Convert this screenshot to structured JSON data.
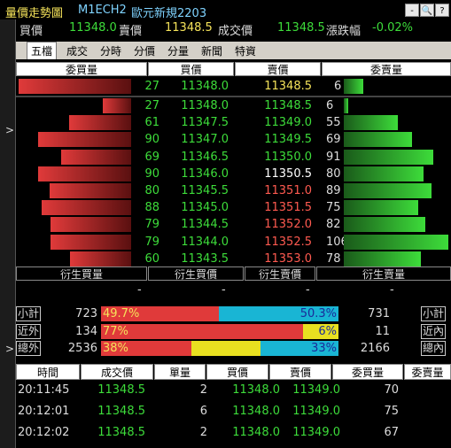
{
  "title_bar": {
    "window_title": "量價走勢圖",
    "symbol": "M1ECH2",
    "name": "歐元新規2203",
    "buttons": [
      "-",
      "🔍",
      "?"
    ]
  },
  "quote_line": {
    "buy_label": "買價",
    "buy_value": "11348.0",
    "sell_label": "賣價",
    "sell_value": "11348.5",
    "trade_label": "成交價",
    "trade_value": "11348.5",
    "change_label": "漲跌幅",
    "change_value": "-0.02%"
  },
  "tabs": [
    {
      "label": "五檔",
      "active": true
    },
    {
      "label": "成交",
      "active": false
    },
    {
      "label": "分時",
      "active": false
    },
    {
      "label": "分價",
      "active": false
    },
    {
      "label": "分量",
      "active": false
    },
    {
      "label": "新聞",
      "active": false
    },
    {
      "label": "特資",
      "active": false
    }
  ],
  "book_header": {
    "bid_qty": "委買量",
    "bid_price": "買價",
    "ask_price": "賣價",
    "ask_qty": "委賣量"
  },
  "summary_row": {
    "bid_qty": "27",
    "bid_price": "11348.0",
    "ask_price": "11348.5",
    "ask_qty": "6",
    "bid_fill": 0.55,
    "ask_fill": 0.08
  },
  "book_rows": [
    {
      "bid_qty": "27",
      "bid_price": "11348.0",
      "ask_price": "11348.5",
      "ask_qty": "6",
      "ask_color": "#3ddc3a",
      "bid_fill": 0.25,
      "ask_fill": 0.04
    },
    {
      "bid_qty": "61",
      "bid_price": "11347.5",
      "ask_price": "11349.0",
      "ask_qty": "55",
      "ask_color": "#3ddc3a",
      "bid_fill": 0.55,
      "ask_fill": 0.52
    },
    {
      "bid_qty": "90",
      "bid_price": "11347.0",
      "ask_price": "11349.5",
      "ask_qty": "69",
      "ask_color": "#3ddc3a",
      "bid_fill": 0.82,
      "ask_fill": 0.65
    },
    {
      "bid_qty": "69",
      "bid_price": "11346.5",
      "ask_price": "11350.0",
      "ask_qty": "91",
      "ask_color": "#3ddc3a",
      "bid_fill": 0.62,
      "ask_fill": 0.86
    },
    {
      "bid_qty": "90",
      "bid_price": "11346.0",
      "ask_price": "11350.5",
      "ask_qty": "80",
      "ask_color": "#ffffff",
      "bid_fill": 0.82,
      "ask_fill": 0.76
    },
    {
      "bid_qty": "80",
      "bid_price": "11345.5",
      "ask_price": "11351.0",
      "ask_qty": "89",
      "ask_color": "#ff5a50",
      "bid_fill": 0.72,
      "ask_fill": 0.84
    },
    {
      "bid_qty": "88",
      "bid_price": "11345.0",
      "ask_price": "11351.5",
      "ask_qty": "75",
      "ask_color": "#ff5a50",
      "bid_fill": 0.79,
      "ask_fill": 0.71
    },
    {
      "bid_qty": "79",
      "bid_price": "11344.5",
      "ask_price": "11352.0",
      "ask_qty": "82",
      "ask_color": "#ff5a50",
      "bid_fill": 0.71,
      "ask_fill": 0.78
    },
    {
      "bid_qty": "79",
      "bid_price": "11344.0",
      "ask_price": "11352.5",
      "ask_qty": "106",
      "ask_color": "#ff5a50",
      "bid_fill": 0.71,
      "ask_fill": 1.0
    },
    {
      "bid_qty": "60",
      "bid_price": "11343.5",
      "ask_price": "11353.0",
      "ask_qty": "78",
      "ask_color": "#ff5a50",
      "bid_fill": 0.54,
      "ask_fill": 0.74
    }
  ],
  "derived_header": {
    "bid_qty": "衍生買量",
    "bid_price": "衍生買價",
    "ask_price": "衍生賣價",
    "ask_qty": "衍生賣量"
  },
  "derived_values": {
    "bid_qty": "-",
    "bid_price": "-",
    "ask_price": "-",
    "ask_qty": "-"
  },
  "stats": [
    {
      "label": "小計",
      "left_value": "723",
      "left_pct": "49.7%",
      "right_pct": "50.3%",
      "right_value": "731",
      "right_label": "小計",
      "segments": [
        {
          "color": "#e03a3a",
          "frac": 0.497
        },
        {
          "color": "#19b5d4",
          "frac": 0.503
        }
      ]
    },
    {
      "label": "近外",
      "left_value": "134",
      "left_pct": "77%",
      "right_pct": "6%",
      "right_value": "11",
      "right_label": "近內",
      "segments": [
        {
          "color": "#e03a3a",
          "frac": 0.85
        },
        {
          "color": "#e8e020",
          "frac": 0.15
        }
      ]
    },
    {
      "label": "總外",
      "left_value": "2536",
      "left_pct": "38%",
      "right_pct": "33%",
      "right_value": "2166",
      "right_label": "總內",
      "segments": [
        {
          "color": "#e03a3a",
          "frac": 0.38
        },
        {
          "color": "#e8e020",
          "frac": 0.29
        },
        {
          "color": "#19b5d4",
          "frac": 0.33
        }
      ]
    }
  ],
  "trades_header": [
    "時間",
    "成交價",
    "單量",
    "買價",
    "賣價",
    "委買量",
    "委賣量"
  ],
  "trades": [
    {
      "time": "20:11:45",
      "price": "11348.5",
      "qty": "2",
      "bid": "11348.0",
      "ask": "11349.0",
      "bid_qty": "70"
    },
    {
      "time": "20:12:01",
      "price": "11348.5",
      "qty": "6",
      "bid": "11348.0",
      "ask": "11349.0",
      "bid_qty": "75"
    },
    {
      "time": "20:12:02",
      "price": "11348.5",
      "qty": "2",
      "bid": "11348.0",
      "ask": "11349.0",
      "bid_qty": "67"
    }
  ],
  "colors": {
    "bid_price": "#3ddc3a",
    "ask_price_base": "#f5e35a",
    "text": "#dddddd"
  }
}
